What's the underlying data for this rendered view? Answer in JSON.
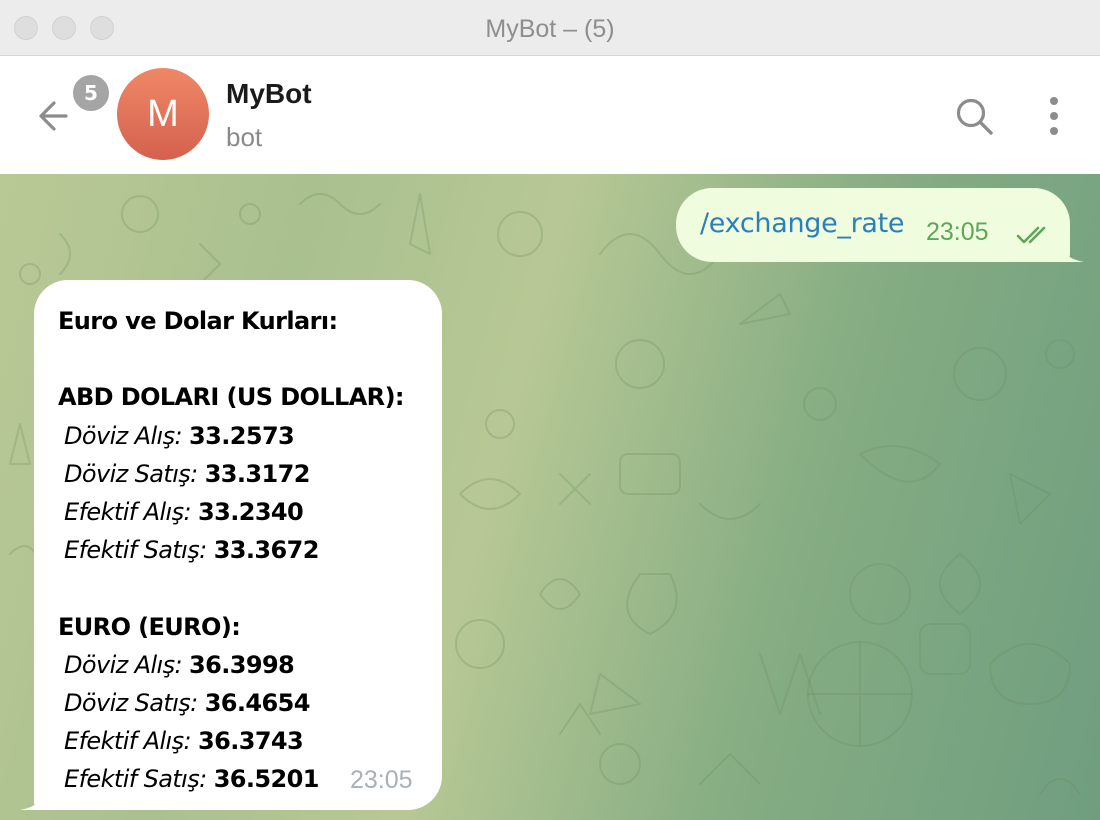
{
  "window": {
    "title": "MyBot – (5)"
  },
  "header": {
    "unread_badge": "5",
    "avatar_letter": "M",
    "chat_name": "MyBot",
    "chat_status": "bot",
    "icons": {
      "back": "back-arrow-icon",
      "search": "search-icon",
      "more": "more-vertical-icon"
    }
  },
  "messages": {
    "outgoing": {
      "text": "/exchange_rate",
      "time": "23:05",
      "status_icon": "double-check-icon"
    },
    "incoming": {
      "title": "Euro ve Dolar Kurları:",
      "sections": [
        {
          "heading": "ABD DOLARI (US DOLLAR):",
          "rates": [
            {
              "label": "Döviz Alış:",
              "value": "33.2573"
            },
            {
              "label": "Döviz Satış:",
              "value": "33.3172"
            },
            {
              "label": "Efektif Alış:",
              "value": "33.2340"
            },
            {
              "label": "Efektif Satış:",
              "value": "33.3672"
            }
          ]
        },
        {
          "heading": "EURO (EURO):",
          "rates": [
            {
              "label": "Döviz Alış:",
              "value": "36.3998"
            },
            {
              "label": "Döviz Satış:",
              "value": "36.4654"
            },
            {
              "label": "Efektif Alış:",
              "value": "36.3743"
            },
            {
              "label": "Efektif Satış:",
              "value": "36.5201"
            }
          ]
        }
      ],
      "time": "23:05"
    }
  },
  "colors": {
    "avatar": "#e07258",
    "badge": "#a5a5a5",
    "outgoing_bubble": "#effdde",
    "command_link": "#2d7ebf",
    "outgoing_time": "#5fa55a",
    "incoming_time": "#a8b0b8"
  }
}
